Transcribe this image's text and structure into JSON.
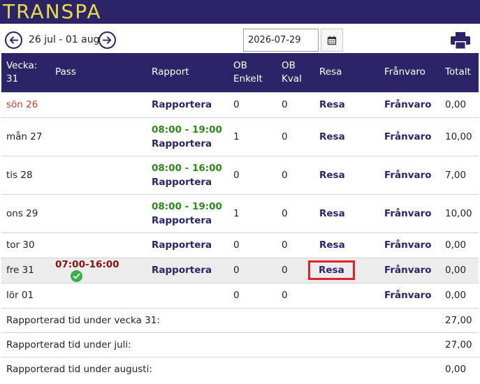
{
  "app": {
    "brand": "TRANSPA"
  },
  "nav": {
    "range": "26 jul - 01 aug",
    "date_value": "2026-07-29"
  },
  "table": {
    "headers": {
      "week": "Vecka:",
      "week_no": "31",
      "pass": "Pass",
      "rapport": "Rapport",
      "ob_enkelt_1": "OB",
      "ob_enkelt_2": "Enkelt",
      "ob_kval_1": "OB",
      "ob_kval_2": "Kval",
      "resa": "Resa",
      "franvaro": "Frånvaro",
      "totalt": "Totalt"
    },
    "rows": [
      {
        "day": "sön 26",
        "pass": "",
        "shift": "",
        "rapport": "Rapportera",
        "ob_enkelt": "0",
        "ob_kval": "0",
        "resa": "Resa",
        "franvaro": "Frånvaro",
        "totalt": "0,00"
      },
      {
        "day": "mån 27",
        "pass": "",
        "shift": "08:00 - 19:00",
        "rapport": "Rapportera",
        "ob_enkelt": "1",
        "ob_kval": "0",
        "resa": "Resa",
        "franvaro": "Frånvaro",
        "totalt": "10,00"
      },
      {
        "day": "tis 28",
        "pass": "",
        "shift": "08:00 - 16:00",
        "rapport": "Rapportera",
        "ob_enkelt": "0",
        "ob_kval": "0",
        "resa": "Resa",
        "franvaro": "Frånvaro",
        "totalt": "7,00"
      },
      {
        "day": "ons 29",
        "pass": "",
        "shift": "08:00 - 19:00",
        "rapport": "Rapportera",
        "ob_enkelt": "1",
        "ob_kval": "0",
        "resa": "Resa",
        "franvaro": "Frånvaro",
        "totalt": "10,00"
      },
      {
        "day": "tor 30",
        "pass": "",
        "shift": "",
        "rapport": "Rapportera",
        "ob_enkelt": "0",
        "ob_kval": "0",
        "resa": "Resa",
        "franvaro": "Frånvaro",
        "totalt": "0,00"
      },
      {
        "day": "fre 31",
        "pass": "07:00-16:00",
        "shift": "",
        "rapport": "Rapportera",
        "ob_enkelt": "0",
        "ob_kval": "0",
        "resa": "Resa",
        "franvaro": "Frånvaro",
        "totalt": "0,00"
      },
      {
        "day": "lör 01",
        "pass": "",
        "shift": "",
        "rapport": "",
        "ob_enkelt": "0",
        "ob_kval": "0",
        "resa": "",
        "franvaro": "Frånvaro",
        "totalt": "0,00"
      }
    ],
    "summary": [
      {
        "label": "Rapporterad tid under vecka 31:",
        "value": "27,00"
      },
      {
        "label": "Rapporterad tid under juli:",
        "value": "27,00"
      },
      {
        "label": "Rapporterad tid under augusti:",
        "value": "0,00"
      }
    ]
  },
  "colors": {
    "header_bg": "#2d2369",
    "brand_text": "#e8dd4a",
    "shift_green": "#2a8a1a",
    "sunday_red": "#d23a2c",
    "pass_red": "#8a1010",
    "highlight_box": "#e0202a"
  },
  "icons": {
    "prev": "arrow-left-circle-icon",
    "next": "arrow-right-circle-icon",
    "calendar": "calendar-icon",
    "print": "printer-icon",
    "check": "check-circle-icon"
  }
}
